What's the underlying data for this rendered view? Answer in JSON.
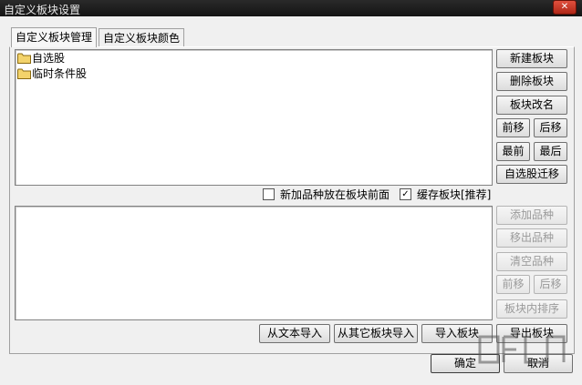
{
  "window": {
    "title": "自定义板块设置",
    "close_glyph": "✕"
  },
  "tabs": [
    {
      "label": "自定义板块管理",
      "active": true
    },
    {
      "label": "自定义板块颜色",
      "active": false
    }
  ],
  "blocks": [
    {
      "label": "自选股"
    },
    {
      "label": "临时条件股"
    }
  ],
  "block_buttons": {
    "new": "新建板块",
    "delete": "删除板块",
    "rename": "板块改名",
    "move_up": "前移",
    "move_down": "后移",
    "first": "最前",
    "last": "最后",
    "migrate": "自选股迁移"
  },
  "options": {
    "new_items_front": {
      "label": "新加品种放在板块前面",
      "checked": false
    },
    "cache_block": {
      "label": "缓存板块[推荐]",
      "checked": true
    }
  },
  "item_buttons": {
    "add": "添加品种",
    "remove": "移出品种",
    "clear": "清空品种",
    "move_up": "前移",
    "move_down": "后移",
    "sort": "板块内排序"
  },
  "io_buttons": {
    "import_text": "从文本导入",
    "import_other": "从其它板块导入",
    "import_block": "导入板块",
    "export_block": "导出板块"
  },
  "dialog": {
    "ok": "确定",
    "cancel": "取消"
  },
  "colors": {
    "titlebar": "#1e1e1e",
    "folder": "#f3d36b"
  }
}
